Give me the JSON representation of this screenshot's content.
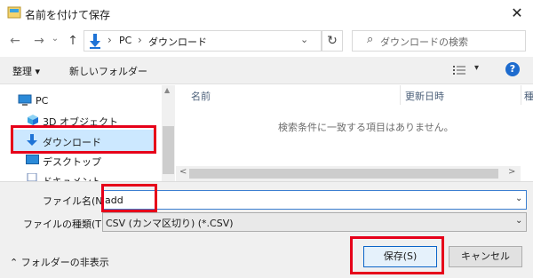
{
  "window": {
    "title": "名前を付けて保存",
    "close_glyph": "✕"
  },
  "nav": {
    "back_glyph": "←",
    "forward_glyph": "→",
    "recent_glyph": "⌄",
    "up_glyph": "↑",
    "address": {
      "chevron": "›",
      "segments": [
        "PC",
        "ダウンロード"
      ],
      "dropdown_glyph": "⌄"
    },
    "refresh_glyph": "↻",
    "search": {
      "placeholder": "ダウンロードの検索",
      "icon_glyph": "⌕"
    }
  },
  "toolbar": {
    "organize_label": "整理 ▾",
    "new_folder_label": "新しいフォルダー",
    "view_dropdown_glyph": "▾",
    "help_glyph": "?"
  },
  "sidebar": {
    "items": [
      {
        "label": "PC",
        "icon": "computer-icon"
      },
      {
        "label": "3D オブジェクト",
        "icon": "cube-icon"
      },
      {
        "label": "ダウンロード",
        "icon": "download-arrow-icon",
        "selected": true
      },
      {
        "label": "デスクトップ",
        "icon": "desktop-icon"
      },
      {
        "label": "ドキュメント",
        "icon": "document-icon"
      }
    ],
    "scroll_up_glyph": "▲"
  },
  "file_list": {
    "columns": [
      "名前",
      "更新日時",
      "種"
    ],
    "empty_message": "検索条件に一致する項目はありません。",
    "scroll_left_glyph": "<",
    "scroll_right_glyph": ">"
  },
  "form": {
    "file_name_label": "ファイル名(N):",
    "file_name_value": "add",
    "file_type_label": "ファイルの種類(T):",
    "file_type_value": "CSV (カンマ区切り) (*.CSV)",
    "dropdown_glyph": "⌄"
  },
  "footer": {
    "hide_folders_label": "⌃  フォルダーの非表示",
    "save_label": "保存(S)",
    "cancel_label": "キャンセル"
  },
  "colors": {
    "highlight": "#e6001a",
    "selection": "#cce8ff",
    "accent": "#0a64c8",
    "help": "#1d6bce"
  }
}
